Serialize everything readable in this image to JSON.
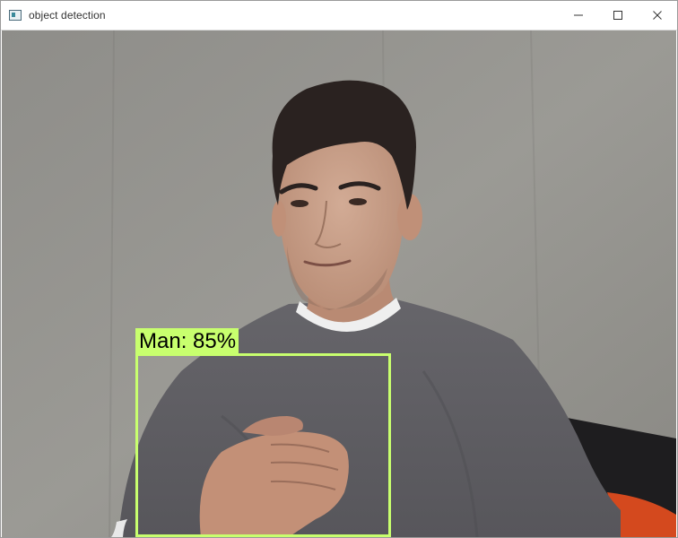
{
  "window": {
    "title": "object detection",
    "icon": "app-window-icon",
    "controls": [
      "minimize-icon",
      "maximize-icon",
      "close-icon"
    ]
  },
  "detection": {
    "label": "Man: 85%",
    "box_color": "#c8ff6e"
  },
  "colors": {
    "wall": "#8d8c88",
    "shirt": "#5f5e63",
    "skin": "#c9a08a",
    "hair": "#2a2220",
    "chair": "#d44a1f"
  }
}
